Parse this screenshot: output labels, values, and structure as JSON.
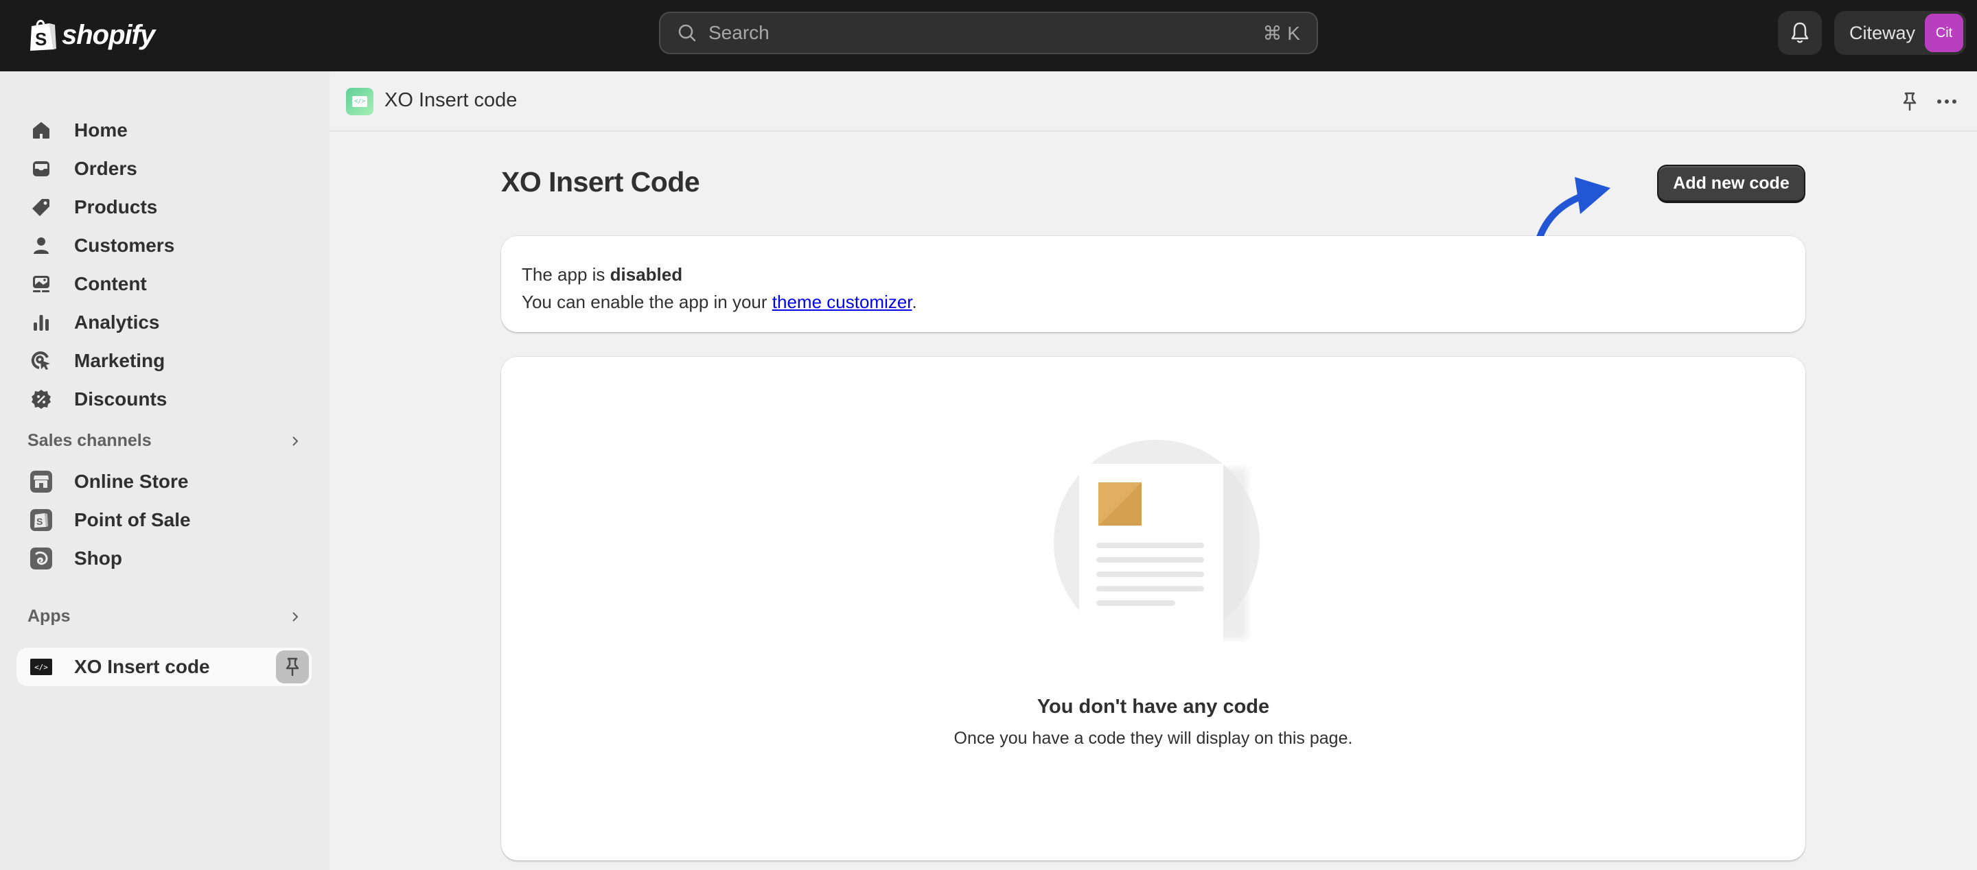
{
  "topbar": {
    "brand": "shopify",
    "search": {
      "placeholder": "Search",
      "shortcut": "⌘ K"
    },
    "account": {
      "name": "Citeway",
      "avatar_initials": "Cit",
      "avatar_color": "#b840c0"
    }
  },
  "sidebar": {
    "items": [
      {
        "label": "Home",
        "icon": "home-icon"
      },
      {
        "label": "Orders",
        "icon": "inbox-icon"
      },
      {
        "label": "Products",
        "icon": "tag-icon"
      },
      {
        "label": "Customers",
        "icon": "person-icon"
      },
      {
        "label": "Content",
        "icon": "image-icon"
      },
      {
        "label": "Analytics",
        "icon": "bar-chart-icon"
      },
      {
        "label": "Marketing",
        "icon": "target-icon"
      },
      {
        "label": "Discounts",
        "icon": "discount-icon"
      }
    ],
    "sales_channels": {
      "title": "Sales channels",
      "items": [
        {
          "label": "Online Store",
          "icon": "store-icon"
        },
        {
          "label": "Point of Sale",
          "icon": "pos-icon"
        },
        {
          "label": "Shop",
          "icon": "shop-icon"
        }
      ]
    },
    "apps": {
      "title": "Apps",
      "items": [
        {
          "label": "XO Insert code",
          "icon": "code-icon",
          "active": true
        }
      ]
    }
  },
  "main": {
    "header_title": "XO Insert code",
    "page_title": "XO Insert Code",
    "add_button": "Add new code",
    "status": {
      "prefix": "The app is ",
      "state": "disabled",
      "line2_prefix": "You can enable the app in your ",
      "link_text": "theme customizer",
      "line2_suffix": "."
    },
    "empty_state": {
      "title": "You don't have any code",
      "description": "Once you have a code they will display on this page."
    },
    "annotation_arrow_color": "#2356d4"
  }
}
